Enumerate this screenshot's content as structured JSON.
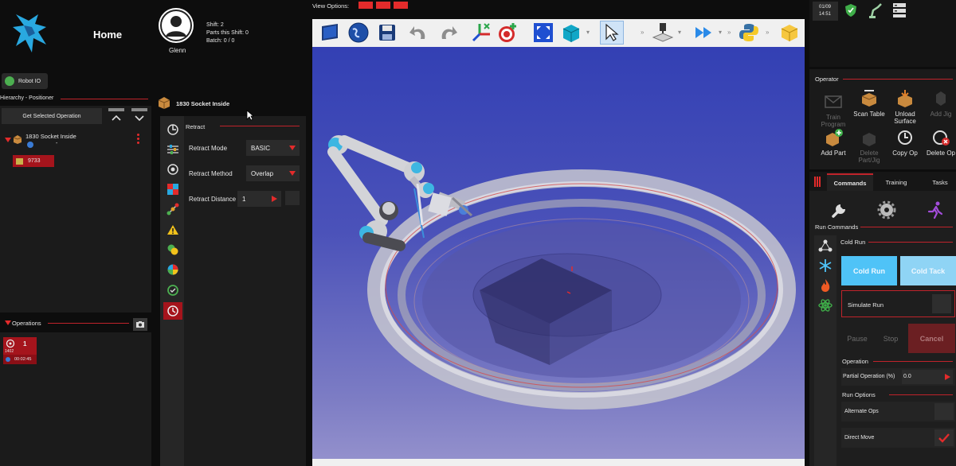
{
  "header": {
    "title": "Home",
    "user_name": "Glenn",
    "shift": "Shift: 2",
    "parts_this_shift": "Parts this Shift: 0",
    "batch": "Batch: 0 / 0",
    "robot_io_label": "Robot IO",
    "view_options_label": "View Options:",
    "date": "01/09",
    "time": "14:51"
  },
  "hierarchy": {
    "title": "Hierarchy - Positioner",
    "get_selected_label": "Get Selected Operation",
    "item_name": "1830 Socket Inside",
    "item_sub": "-",
    "badge_value": "9733"
  },
  "operations": {
    "title": "Operations",
    "card_number": "1",
    "card_id": "1402",
    "card_time": "00:02:45"
  },
  "op_panel": {
    "title": "1830 Socket Inside",
    "section_title": "Retract",
    "fields": [
      {
        "label": "Retract Mode",
        "value": "BASIC"
      },
      {
        "label": "Retract Method",
        "value": "Overlap"
      },
      {
        "label": "Retract Distance",
        "value": "1"
      }
    ]
  },
  "operator": {
    "title": "Operator",
    "buttons": [
      {
        "label": "Train Program",
        "enabled": false
      },
      {
        "label": "Scan Table",
        "enabled": true
      },
      {
        "label": "Unload Surface",
        "enabled": true
      },
      {
        "label": "Add Jig",
        "enabled": false
      },
      {
        "label": "Add Part",
        "enabled": true
      },
      {
        "label": "Delete Part/Jig",
        "enabled": false
      },
      {
        "label": "Copy Op",
        "enabled": true
      },
      {
        "label": "Delete Op",
        "enabled": true
      }
    ]
  },
  "tabs": [
    {
      "label": "Commands",
      "active": true
    },
    {
      "label": "Training",
      "active": false
    },
    {
      "label": "Tasks",
      "active": false
    }
  ],
  "commands": {
    "run_commands_label": "Run Commands",
    "cold_run_section": "Cold Run",
    "cold_run_button": "Cold Run",
    "cold_tack_button": "Cold Tack",
    "simulate_run_label": "Simulate Run",
    "pause_label": "Pause",
    "stop_label": "Stop",
    "cancel_label": "Cancel",
    "operation_section": "Operation",
    "partial_op_label": "Partial Operation (%)",
    "partial_op_value": "0.0",
    "run_options_section": "Run Options",
    "alternate_ops_label": "Alternate Ops",
    "direct_move_label": "Direct Move"
  },
  "colors": {
    "accent_red": "#c0232b",
    "cold_run_blue": "#4fc3f7",
    "cold_tack_blue": "#8fd4f5",
    "cancel_red": "#6b1f22",
    "viewport_top": "#3a48b8",
    "viewport_bottom": "#8a88c8"
  }
}
